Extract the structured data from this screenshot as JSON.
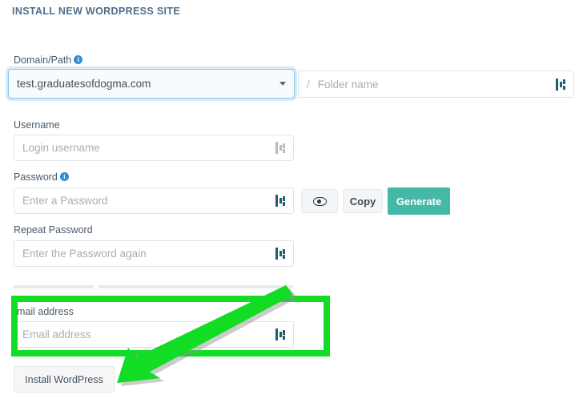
{
  "panel": {
    "title": "INSTALL NEW WORDPRESS SITE"
  },
  "fields": {
    "domain_path": {
      "label": "Domain/Path",
      "info_icon": "info-circle-icon",
      "selected_value": "test.graduatesofdogma.com",
      "caret_icon": "chevron-down-icon"
    },
    "folder": {
      "prefix": "/",
      "placeholder": "Folder name",
      "value": "",
      "autofill_icon": "password-manager-autofill-icon"
    },
    "username": {
      "label": "Username",
      "placeholder": "Login username",
      "value": "",
      "autofill_icon": "password-manager-autofill-icon"
    },
    "password": {
      "label": "Password",
      "info_icon": "info-circle-icon",
      "placeholder": "Enter a Password",
      "value": "",
      "autofill_icon": "password-manager-autofill-icon"
    },
    "repeat_password": {
      "label": "Repeat Password",
      "placeholder": "Enter the Password again",
      "value": "",
      "autofill_icon": "password-manager-autofill-icon"
    },
    "email": {
      "label": "mail address",
      "placeholder": "Email address",
      "value": "",
      "autofill_icon": "password-manager-autofill-icon"
    }
  },
  "buttons": {
    "show_password": {
      "icon": "eye-icon",
      "label": ""
    },
    "copy_password": {
      "label": "Copy"
    },
    "generate_password": {
      "label": "Generate"
    },
    "install": {
      "label": "Install WordPress"
    }
  },
  "annotations": {
    "highlight_box": {
      "target": "email-address-field",
      "color": "#12dc24"
    },
    "arrow": {
      "points_to": "email-address-field",
      "color": "#12dc24",
      "shadow_color": "#9a9a9a"
    }
  },
  "colors": {
    "accent_teal": "#46b8a8",
    "title_text": "#4e6e8e",
    "label_text": "#4a5a6a",
    "placeholder_text": "#a7aeb6",
    "field_border": "#dfe3e8",
    "focus_border": "#8ec7e6",
    "info_icon_blue": "#2f8fd0",
    "annotation_green": "#12dc24",
    "page_background": "#ffffff"
  }
}
